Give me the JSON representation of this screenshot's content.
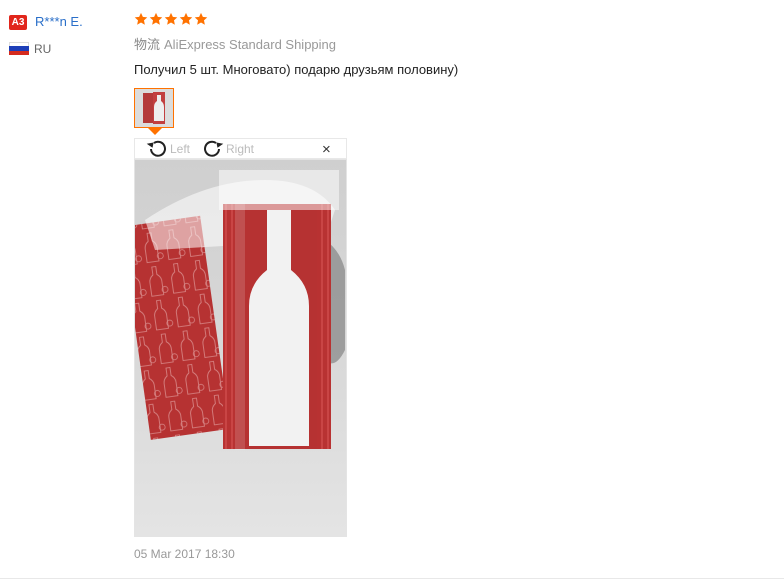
{
  "user": {
    "level_badge": "A3",
    "name": "R***n E.",
    "country": "RU",
    "flag_colors": [
      "#ffffff",
      "#1d3fb8",
      "#d52b1e"
    ]
  },
  "review": {
    "rating": 5,
    "rating_max": 5,
    "star_color": "#ff7200",
    "shipping_label": "物流",
    "shipping_method": "AliExpress Standard Shipping",
    "text": "Получил 5 шт. Многовато) подарю друзьям половину)",
    "timestamp": "05 Mar 2017 18:30"
  },
  "viewer": {
    "rotate_left_label": "Left",
    "rotate_right_label": "Right",
    "close_glyph": "×",
    "icons": [
      "rotate-left-icon",
      "rotate-right-icon",
      "close-icon"
    ]
  },
  "colors": {
    "accent": "#ff7200",
    "username": "#2a6fc9",
    "badge": "#e1251b"
  }
}
